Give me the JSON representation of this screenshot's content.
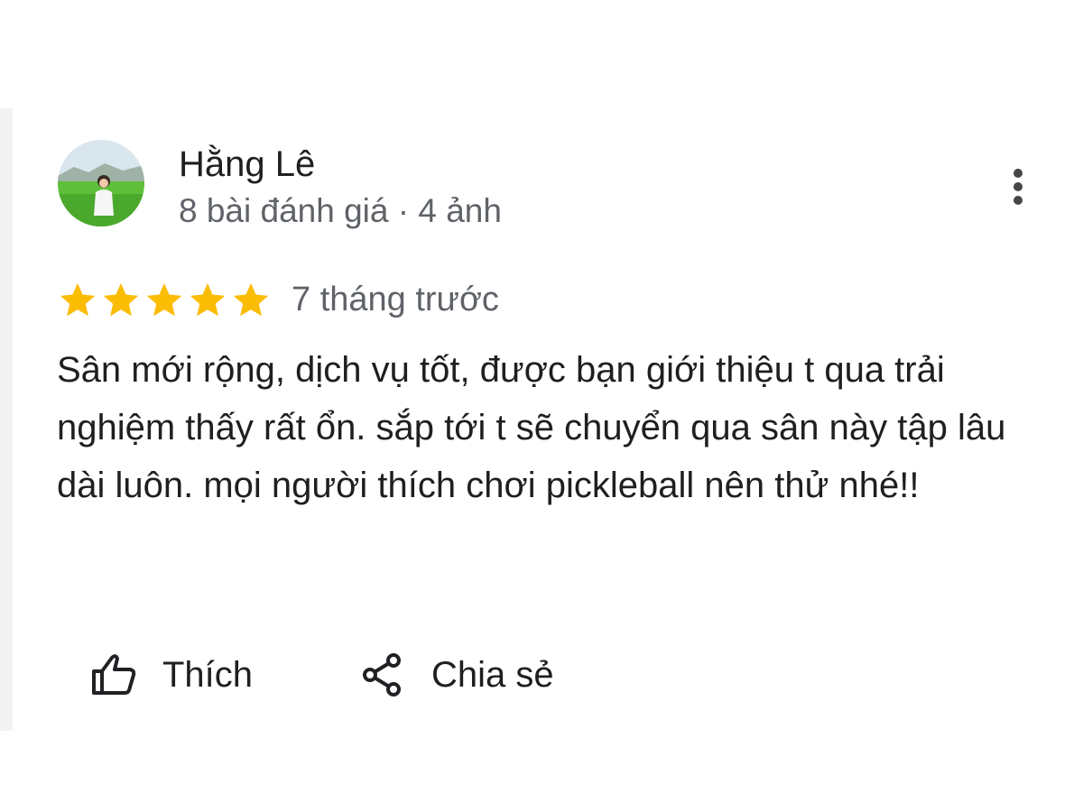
{
  "review": {
    "author": {
      "name": "Hằng Lê",
      "meta": "8 bài đánh giá · 4 ảnh",
      "avatar_icon": "user-photo-avatar"
    },
    "rating": 5,
    "rating_max": 5,
    "time": "7 tháng trước",
    "text": "Sân mới rộng, dịch vụ tốt, được bạn giới thiệu t qua trải nghiệm thấy rất ổn. sắp tới t sẽ chuyển qua sân này tập lâu dài luôn. mọi người thích chơi pickleball nên thử nhé!!",
    "actions": {
      "like_label": "Thích",
      "share_label": "Chia sẻ"
    }
  },
  "colors": {
    "star": "#fbbc04",
    "text_primary": "#1f1f1f",
    "text_secondary": "#5f6368",
    "icon": "#202124"
  },
  "icons": {
    "more": "more-vert-icon",
    "like": "thumb-up-outline-icon",
    "share": "share-icon",
    "star": "star-icon"
  }
}
